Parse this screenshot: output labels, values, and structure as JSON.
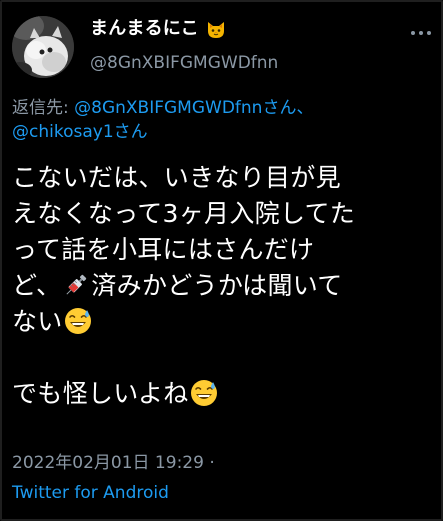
{
  "tweet": {
    "display_name": "まんまるにこ",
    "display_name_emoji": "cat-face-emoji",
    "handle": "@8GnXBIFGMGWDfnn",
    "reply_prefix": "返信先: ",
    "reply_mention_1": "@8GnXBIFGMGWDfnn",
    "reply_san_1": "さん、",
    "reply_mention_2": "@chikosay1",
    "reply_san_2": "さん",
    "body_line_1": "こないだは、いきなり目が見",
    "body_line_2": "えなくなって3ヶ月入院してた",
    "body_line_3": "って話を小耳にはさんだけ",
    "body_line_4_a": "ど、",
    "body_line_4_b": "済みかどうかは聞いて",
    "body_line_5": "ない",
    "body_line_6": "でも怪しいよね",
    "emoji_syringe": "syringe-emoji",
    "emoji_sweat_smile": "grinning-sweat-emoji",
    "timestamp": "2022年02月01日 19:29 ·",
    "source": "Twitter for Android"
  },
  "colors": {
    "background": "#000000",
    "text": "#ffffff",
    "secondary": "#8b98a5",
    "link": "#1d9bf0"
  }
}
